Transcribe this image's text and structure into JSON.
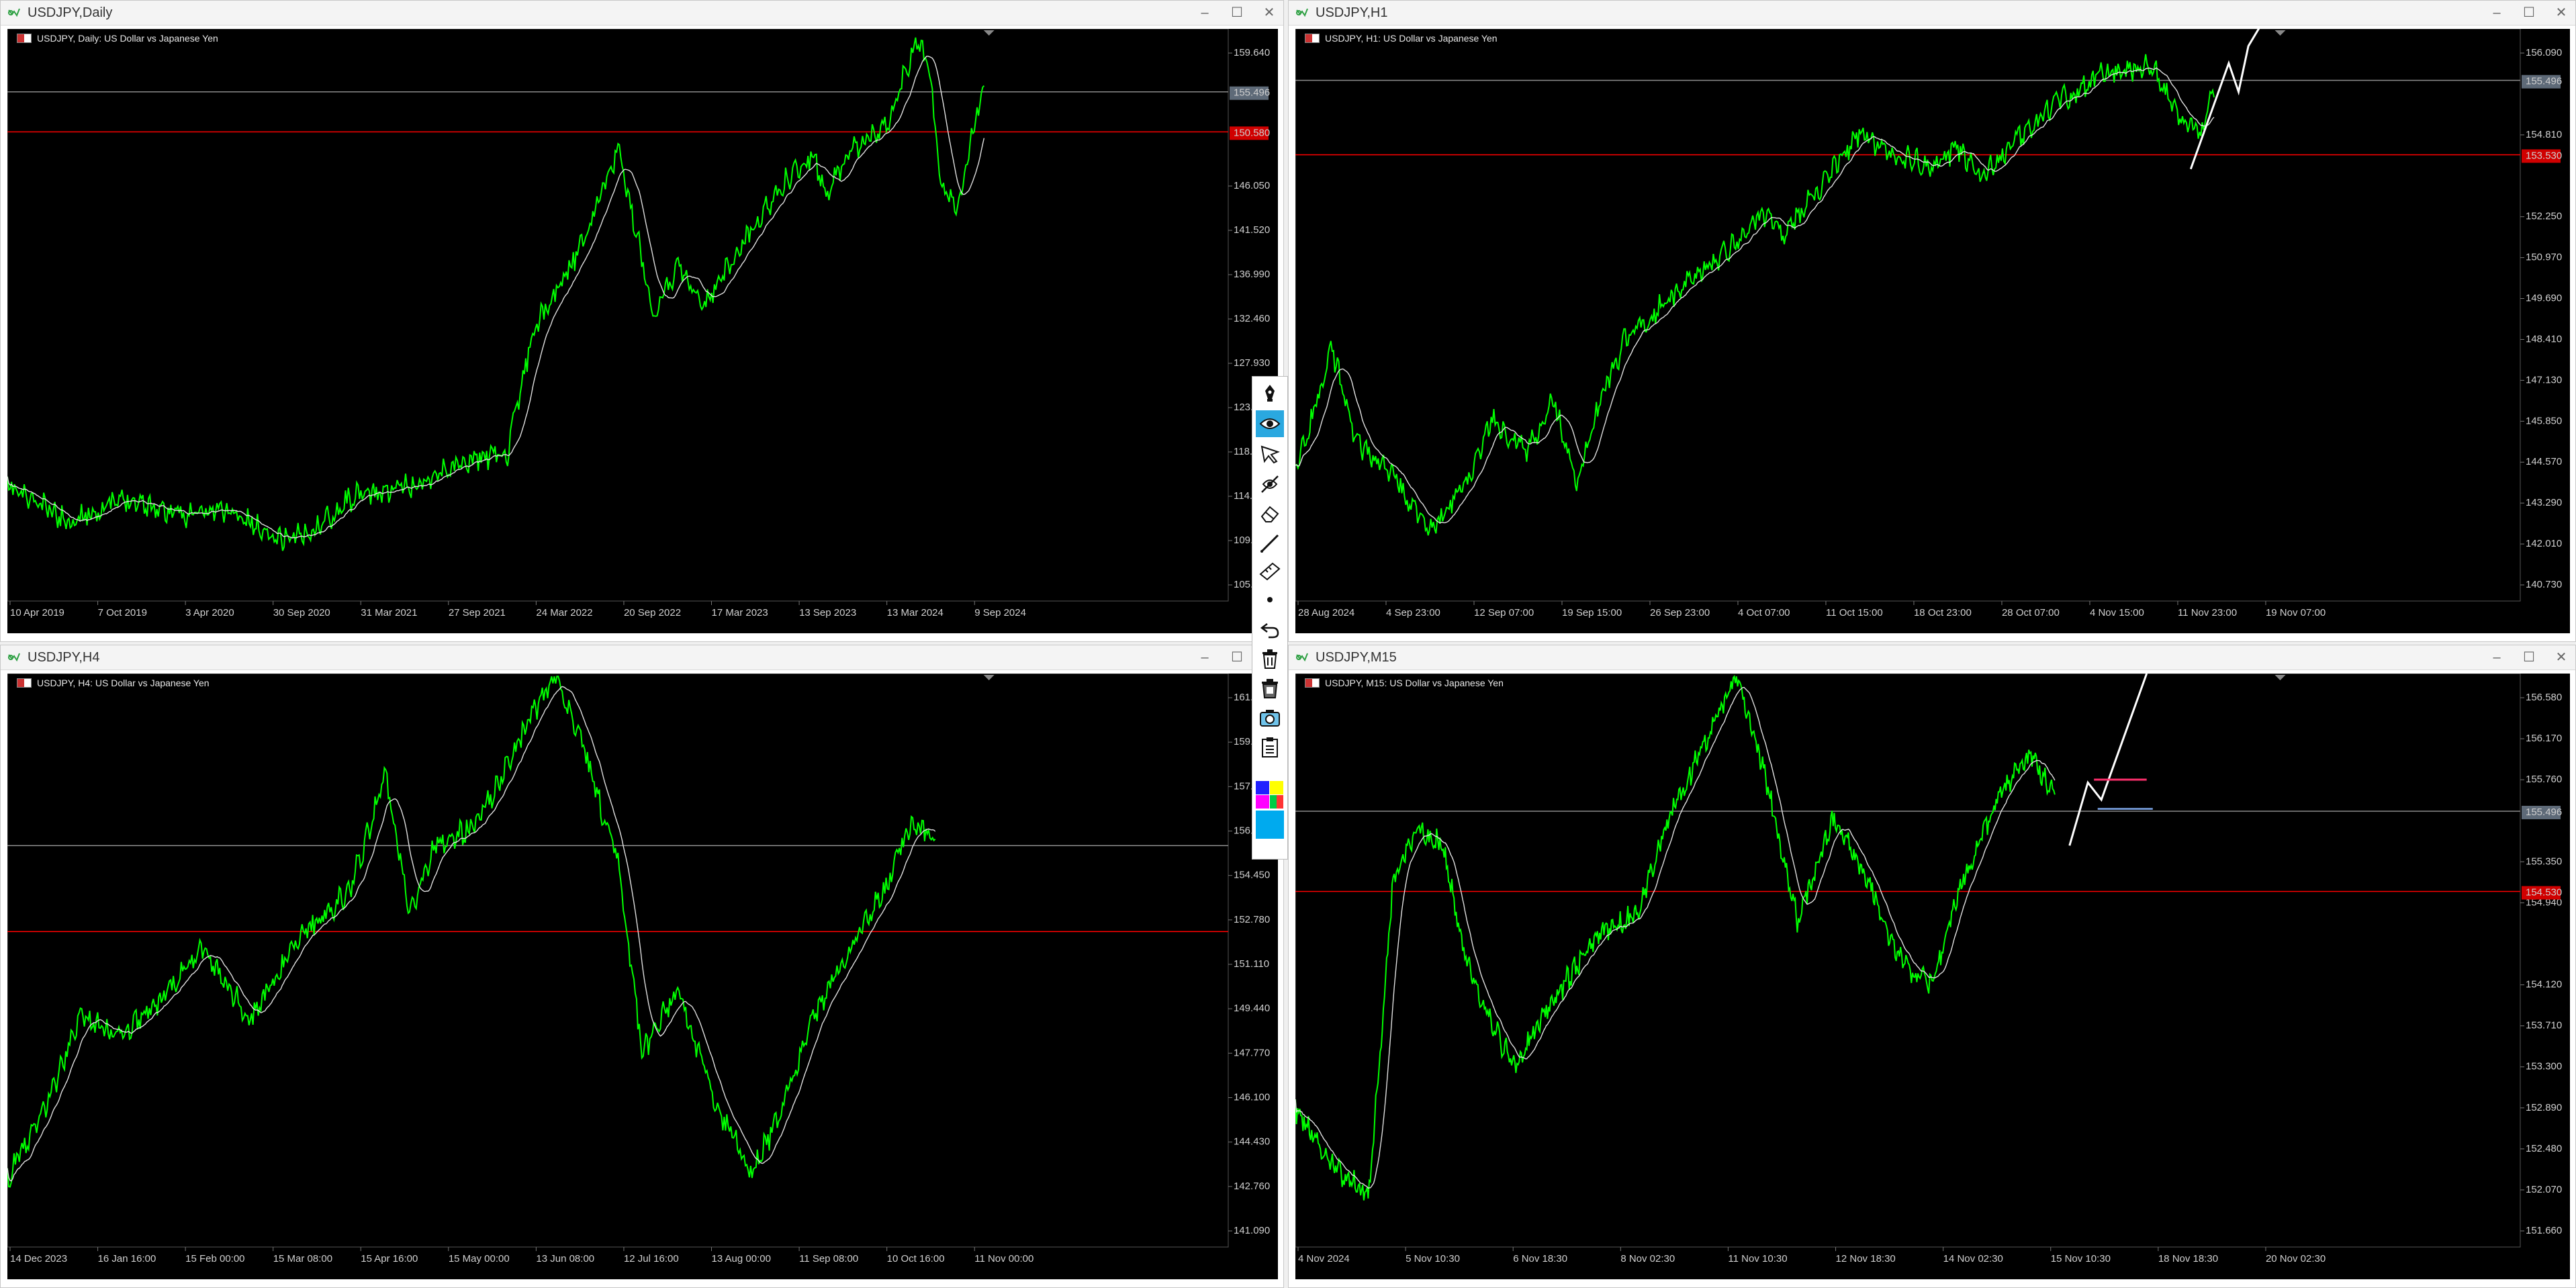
{
  "charts": [
    {
      "id": "daily",
      "window_title": "USDJPY,Daily",
      "label": "USDJPY, Daily:  US Dollar vs Japanese Yen",
      "price_ticks": [
        "159.640",
        "155.496",
        "150.580",
        "146.050",
        "141.520",
        "136.990",
        "132.460",
        "127.930",
        "123.400",
        "118.870",
        "114.340",
        "109.810",
        "105.280"
      ],
      "time_ticks": [
        "10 Apr 2019",
        "7 Oct 2019",
        "3 Apr 2020",
        "30 Sep 2020",
        "31 Mar 2021",
        "27 Sep 2021",
        "24 Mar 2022",
        "20 Sep 2022",
        "17 Mar 2023",
        "13 Sep 2023",
        "13 Mar 2024",
        "9 Sep 2024"
      ],
      "current_price": "155.496",
      "alert_price": "150.580"
    },
    {
      "id": "h1",
      "window_title": "USDJPY,H1",
      "label": "USDJPY, H1:  US Dollar vs Japanese Yen",
      "price_ticks": [
        "156.090",
        "155.496",
        "154.810",
        "153.530",
        "152.250",
        "150.970",
        "149.690",
        "148.410",
        "147.130",
        "145.850",
        "144.570",
        "143.290",
        "142.010",
        "140.730"
      ],
      "time_ticks": [
        "28 Aug 2024",
        "4 Sep 23:00",
        "12 Sep 07:00",
        "19 Sep 15:00",
        "26 Sep 23:00",
        "4 Oct 07:00",
        "11 Oct 15:00",
        "18 Oct 23:00",
        "28 Oct 07:00",
        "4 Nov 15:00",
        "11 Nov 23:00",
        "19 Nov 07:00"
      ],
      "current_price": "155.496",
      "alert_price": "153.530"
    },
    {
      "id": "h4",
      "window_title": "USDJPY,H4",
      "label": "USDJPY, H4:  US Dollar vs Japanese Yen",
      "price_ticks": [
        "161.1",
        "159.4",
        "157.8",
        "156.1",
        "154.450",
        "152.780",
        "151.110",
        "149.440",
        "147.770",
        "146.100",
        "144.430",
        "142.760",
        "141.090"
      ],
      "time_ticks": [
        "14 Dec 2023",
        "16 Jan 16:00",
        "15 Feb 00:00",
        "15 Mar 08:00",
        "15 Apr 16:00",
        "15 May 00:00",
        "13 Jun 08:00",
        "12 Jul 16:00",
        "13 Aug 00:00",
        "11 Sep 08:00",
        "10 Oct 16:00",
        "11 Nov 00:00"
      ],
      "current_price": "155.496",
      "alert_price": "152.110"
    },
    {
      "id": "m15",
      "window_title": "USDJPY,M15",
      "label": "USDJPY, M15:  US Dollar vs Japanese Yen",
      "price_ticks": [
        "156.580",
        "156.170",
        "155.760",
        "155.496",
        "155.350",
        "154.940",
        "154.530",
        "154.120",
        "153.710",
        "153.300",
        "152.890",
        "152.480",
        "152.070",
        "151.660"
      ],
      "time_ticks": [
        "4 Nov 2024",
        "5 Nov 10:30",
        "6 Nov 18:30",
        "8 Nov 02:30",
        "11 Nov 10:30",
        "12 Nov 18:30",
        "14 Nov 02:30",
        "15 Nov 10:30",
        "18 Nov 18:30",
        "20 Nov 02:30"
      ],
      "current_price": "155.496",
      "alert_price": "154.530"
    }
  ],
  "colors": {
    "price_line": "#00ff00",
    "ma_line": "#e0e0e0",
    "alert_line": "#ff0000",
    "bid_line": "#8a8a8a",
    "accent": "#2aa8e0"
  },
  "toolbar_icons": [
    "pen-icon",
    "eye-icon",
    "arrow-icon",
    "hidden-eye-icon",
    "eraser-icon",
    "line-icon",
    "ruler-icon",
    "dot-icon",
    "undo-icon",
    "trash-icon",
    "trash-all-icon",
    "screenshot-icon",
    "clipboard-icon",
    "color-palette-icon",
    "color-selected-icon"
  ]
}
